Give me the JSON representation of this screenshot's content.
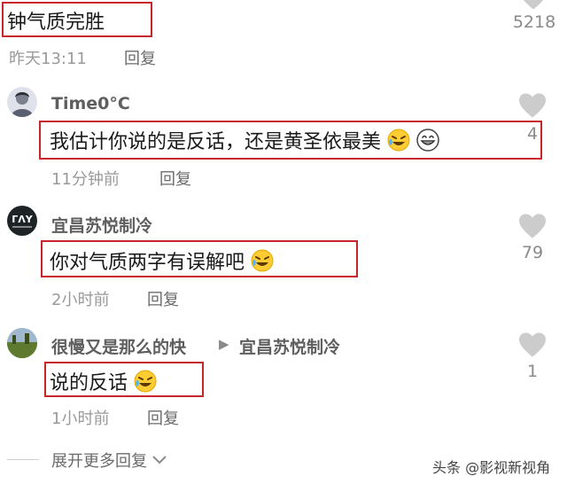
{
  "top_comment": {
    "text": "钟气质完胜",
    "time": "昨天13:11",
    "reply_label": "回复",
    "likes": "5218"
  },
  "replies": [
    {
      "username": "Time0°C",
      "text": "我估计你说的是反话，还是黄圣依最美",
      "time": "11分钟前",
      "reply_label": "回复",
      "likes": "4"
    },
    {
      "username": "宜昌苏悦制冷",
      "text": "你对气质两字有误解吧",
      "time": "2小时前",
      "reply_label": "回复",
      "likes": "79"
    },
    {
      "username": "很慢又是那么的快",
      "reply_to": "宜昌苏悦制冷",
      "text": "说的反话",
      "time": "1小时前",
      "reply_label": "回复",
      "likes": "1"
    }
  ],
  "expand_label": "展开更多回复",
  "watermark": "头条 @影视新视角",
  "colors": {
    "highlight_box": "#c8242b",
    "heart": "#cccccc"
  }
}
